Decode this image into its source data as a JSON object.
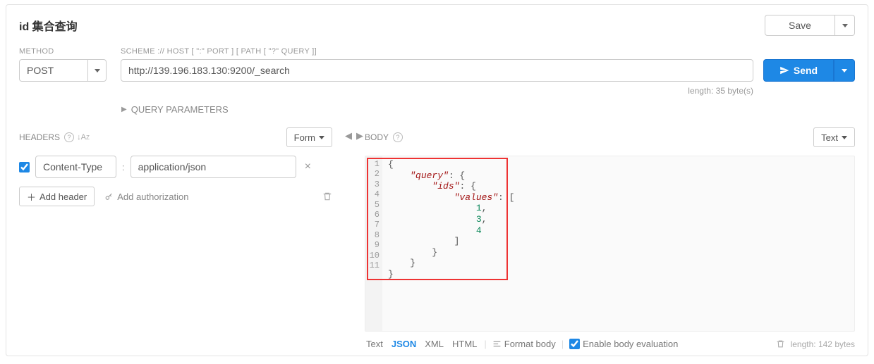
{
  "title": "id 集合查询",
  "save_label": "Save",
  "method": {
    "label": "METHOD",
    "value": "POST"
  },
  "url": {
    "label": "SCHEME :// HOST [ \":\" PORT ] [ PATH [ \"?\" QUERY ]]",
    "value": "http://139.196.183.130:9200/_search"
  },
  "send_label": "Send",
  "url_length": "length: 35 byte(s)",
  "query_params_label": "QUERY PARAMETERS",
  "headers": {
    "title": "HEADERS",
    "form_dropdown": "Form",
    "items": [
      {
        "enabled": true,
        "key": "Content-Type",
        "value": "application/json"
      }
    ],
    "add_header": "Add header",
    "add_auth": "Add authorization"
  },
  "body": {
    "title": "BODY",
    "text_dropdown": "Text",
    "lines": [
      "1",
      "2",
      "3",
      "4",
      "5",
      "6",
      "7",
      "8",
      "9",
      "10",
      "11"
    ],
    "code_tokens": [
      [
        {
          "t": "p",
          "v": "{"
        }
      ],
      [
        {
          "t": "p",
          "v": "    "
        },
        {
          "t": "k",
          "v": "\"query\""
        },
        {
          "t": "p",
          "v": ": {"
        }
      ],
      [
        {
          "t": "p",
          "v": "        "
        },
        {
          "t": "k",
          "v": "\"ids\""
        },
        {
          "t": "p",
          "v": ": {"
        }
      ],
      [
        {
          "t": "p",
          "v": "            "
        },
        {
          "t": "k",
          "v": "\"values\""
        },
        {
          "t": "p",
          "v": ": ["
        }
      ],
      [
        {
          "t": "p",
          "v": "                "
        },
        {
          "t": "n",
          "v": "1"
        },
        {
          "t": "p",
          "v": ","
        }
      ],
      [
        {
          "t": "p",
          "v": "                "
        },
        {
          "t": "n",
          "v": "3"
        },
        {
          "t": "p",
          "v": ","
        }
      ],
      [
        {
          "t": "p",
          "v": "                "
        },
        {
          "t": "n",
          "v": "4"
        }
      ],
      [
        {
          "t": "p",
          "v": "            ]"
        }
      ],
      [
        {
          "t": "p",
          "v": "        }"
        }
      ],
      [
        {
          "t": "p",
          "v": "    }"
        }
      ],
      [
        {
          "t": "p",
          "v": "}"
        }
      ]
    ]
  },
  "body_footer": {
    "tabs": {
      "text": "Text",
      "json": "JSON",
      "xml": "XML",
      "html": "HTML"
    },
    "format": "Format body",
    "enable_eval": "Enable body evaluation",
    "length": "length: 142 bytes"
  }
}
